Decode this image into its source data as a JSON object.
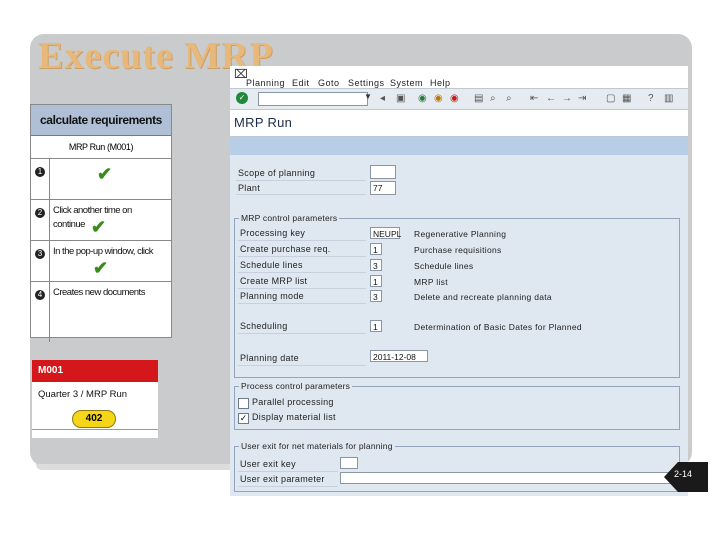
{
  "slide": {
    "title": "Execute MRP",
    "page_number": "2-14"
  },
  "steps": {
    "header": "calculate requirements",
    "subheader": "MRP Run (M001)",
    "items": [
      {
        "number": "1",
        "text": "",
        "checked": true
      },
      {
        "number": "2",
        "text": "Click another time on continue",
        "checked": true
      },
      {
        "number": "3",
        "text": "In the pop-up window, click",
        "checked": true
      },
      {
        "number": "4",
        "text": "Creates new documents",
        "checked": false
      }
    ]
  },
  "m001_card": {
    "header": "M001",
    "line": "Quarter 3 / MRP Run",
    "badge": "402",
    "header_color": "#d3171b",
    "badge_color": "#f4d518"
  },
  "sap": {
    "menu": [
      "Planning",
      "Edit",
      "Goto",
      "Settings",
      "System",
      "Help"
    ],
    "title": "MRP Run",
    "scope_label": "Scope of planning",
    "scope_value": "",
    "plant_label": "Plant",
    "plant_value": "77",
    "control_group_title": "MRP control parameters",
    "params": [
      {
        "label": "Processing key",
        "value": "NEUPL",
        "desc": "Regenerative Planning"
      },
      {
        "label": "Create purchase req.",
        "value": "1",
        "desc": "Purchase requisitions"
      },
      {
        "label": "Schedule lines",
        "value": "3",
        "desc": "Schedule lines"
      },
      {
        "label": "Create MRP list",
        "value": "1",
        "desc": "MRP list"
      },
      {
        "label": "Planning mode",
        "value": "3",
        "desc": "Delete and recreate planning data"
      },
      {
        "label": "Scheduling",
        "value": "1",
        "desc": "Determination of Basic Dates for Planned"
      },
      {
        "label": "Planning date",
        "value": "2011-12-08",
        "desc": ""
      }
    ],
    "process_group_title": "Process control parameters",
    "process_items": [
      {
        "label": "Parallel processing",
        "checked": false
      },
      {
        "label": "Display material list",
        "checked": true
      }
    ],
    "user_exit_group_title": "User exit for net materials for planning",
    "user_exit_key_label": "User exit key",
    "user_exit_param_label": "User exit parameter",
    "accent_color": "#b8cde6"
  }
}
